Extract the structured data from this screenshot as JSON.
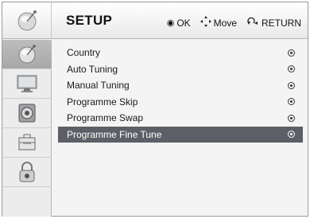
{
  "header": {
    "title": "SETUP",
    "hints": [
      {
        "icon": "ok-button-icon",
        "label": "OK"
      },
      {
        "icon": "move-arrows-icon",
        "label": "Move"
      },
      {
        "icon": "return-icon",
        "label": "RETURN"
      }
    ]
  },
  "sidebar": {
    "items": [
      {
        "icon": "satellite-dish-icon",
        "active": true
      },
      {
        "icon": "tv-monitor-icon",
        "active": false
      },
      {
        "icon": "speaker-icon",
        "active": false
      },
      {
        "icon": "toolbox-icon",
        "active": false
      },
      {
        "icon": "lock-icon",
        "active": false
      }
    ]
  },
  "menu": {
    "items": [
      {
        "label": "Country"
      },
      {
        "label": "Auto Tuning"
      },
      {
        "label": "Manual Tuning"
      },
      {
        "label": "Programme Skip"
      },
      {
        "label": "Programme Swap"
      },
      {
        "label": "Programme Fine Tune"
      }
    ],
    "selected_index": 5
  }
}
